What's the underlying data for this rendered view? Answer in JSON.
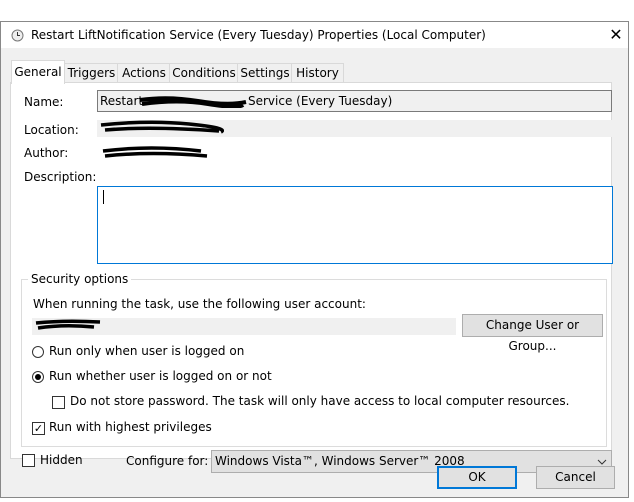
{
  "window": {
    "title": "Restart LiftNotification Service (Every Tuesday) Properties (Local Computer)",
    "close": "✕"
  },
  "tabs": [
    {
      "label": "General"
    },
    {
      "label": "Triggers"
    },
    {
      "label": "Actions"
    },
    {
      "label": "Conditions"
    },
    {
      "label": "Settings"
    },
    {
      "label": "History"
    }
  ],
  "general": {
    "name_label": "Name:",
    "name_prefix": "Restart",
    "name_suffix": "Service (Every Tuesday)",
    "location_label": "Location:",
    "author_label": "Author:",
    "description_label": "Description:",
    "description_value": ""
  },
  "security": {
    "legend": "Security options",
    "account_prompt": "When running the task, use the following user account:",
    "change_button": "Change User or Group...",
    "radio_logged_on": "Run only when user is logged on",
    "radio_whether": "Run whether user is logged on or not",
    "selected_radio": "radio_whether",
    "no_store_password": "Do not store password.  The task will only have access to local computer resources.",
    "no_store_password_checked": false,
    "highest_privileges": "Run with highest privileges",
    "highest_privileges_checked": true
  },
  "hidden_label": "Hidden",
  "hidden_checked": false,
  "configure_label": "Configure for:",
  "configure_value": "Windows Vista™, Windows Server™ 2008",
  "buttons": {
    "ok": "OK",
    "cancel": "Cancel"
  },
  "colors": {
    "accent": "#0078d7"
  }
}
